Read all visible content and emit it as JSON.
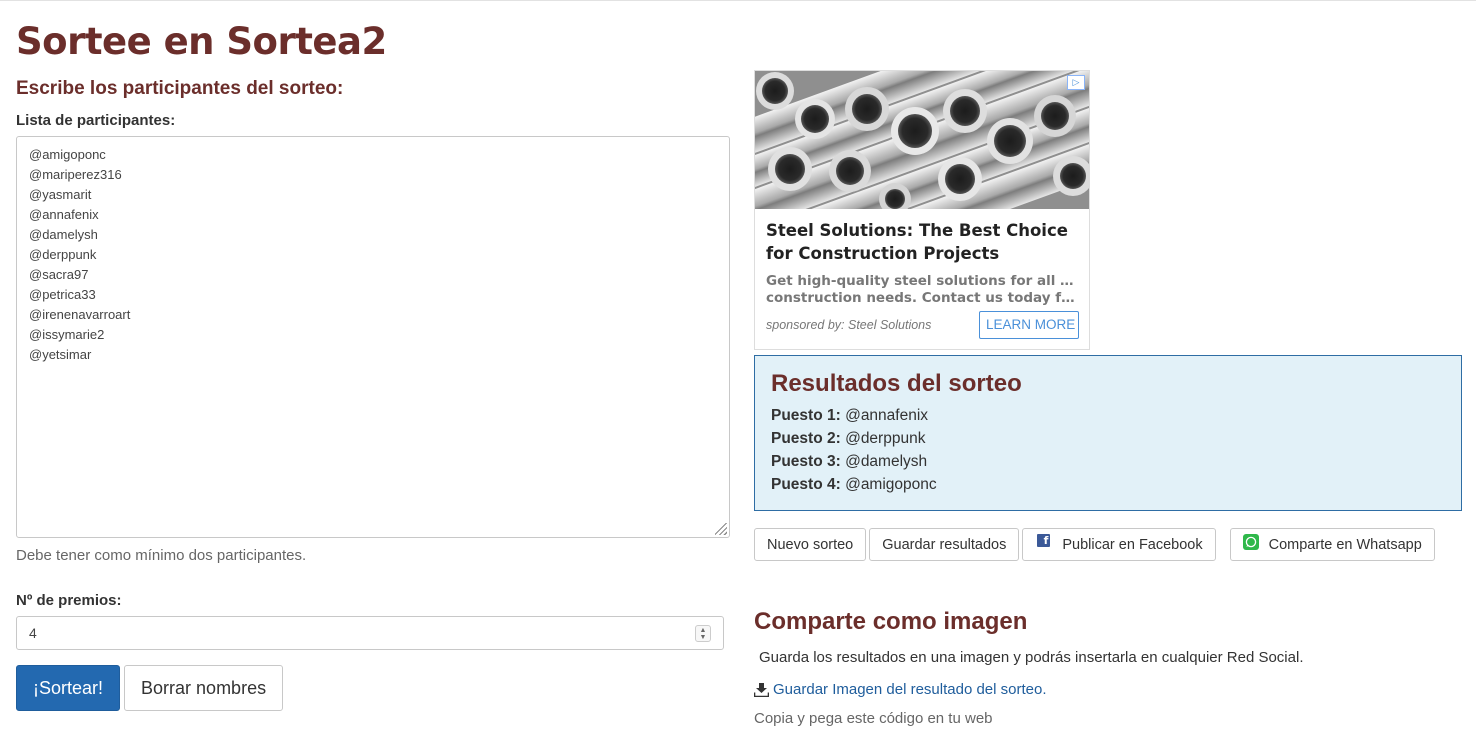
{
  "page": {
    "title": "Sortee en Sortea2"
  },
  "form": {
    "subtitle": "Escribe los participantes del sorteo:",
    "list_label": "Lista de participantes:",
    "participants": [
      "@amigoponc",
      "@mariperez316",
      "@yasmarit",
      "@annafenix",
      "@damelysh",
      "@derppunk",
      "@sacra97",
      "@petrica33",
      "@irenenavarroart",
      "@issymarie2",
      "@yetsimar"
    ],
    "help_text": "Debe tener como mínimo dos participantes.",
    "prizes_label": "Nº de premios:",
    "prizes_value": "4",
    "draw_button": "¡Sortear!",
    "clear_button": "Borrar nombres"
  },
  "ad": {
    "headline": "Steel Solutions: The Best Choice for Construction Projects",
    "description_line1": "Get high-quality steel solutions for all your",
    "description_line2": "construction needs. Contact us today for a...",
    "sponsor": "sponsored by: Steel Solutions",
    "cta": "LEARN MORE",
    "badge": "▷"
  },
  "results": {
    "title": "Resultados del sorteo",
    "rows": [
      {
        "label": "Puesto 1:",
        "value": "@annafenix"
      },
      {
        "label": "Puesto 2:",
        "value": "@derppunk"
      },
      {
        "label": "Puesto 3:",
        "value": "@damelysh"
      },
      {
        "label": "Puesto 4:",
        "value": "@amigoponc"
      }
    ]
  },
  "actions": {
    "new_draw": "Nuevo sorteo",
    "save_results": "Guardar resultados",
    "facebook": "Publicar en Facebook",
    "whatsapp": "Comparte en Whatsapp"
  },
  "share": {
    "title": "Comparte como imagen",
    "text": "Guarda los resultados en una imagen y podrás insertarla en cualquier Red Social.",
    "link": "Guardar Imagen del resultado del sorteo.",
    "copy_text": "Copia y pega este código en tu web"
  },
  "colors": {
    "heading": "#6b2e2b",
    "primary": "#2369b0",
    "results_bg": "#e2f1f8",
    "results_border": "#2e6da4",
    "facebook": "#3b5998",
    "whatsapp": "#2fb84a"
  }
}
